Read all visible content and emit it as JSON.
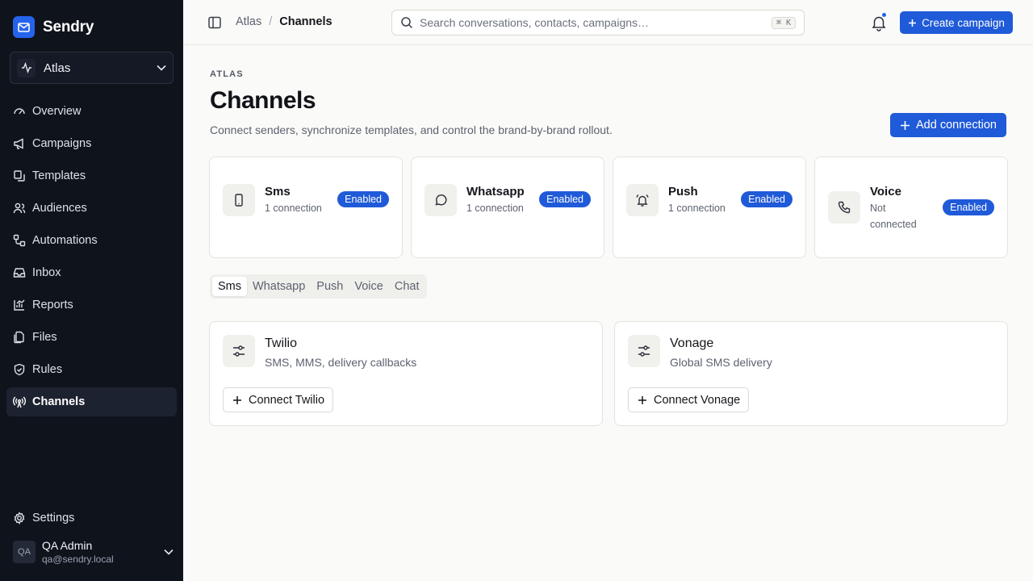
{
  "brand": {
    "name": "Sendry"
  },
  "workspace": {
    "name": "Atlas"
  },
  "sidebar": {
    "items": [
      {
        "label": "Overview",
        "icon": "gauge-icon"
      },
      {
        "label": "Campaigns",
        "icon": "megaphone-icon"
      },
      {
        "label": "Templates",
        "icon": "templates-icon"
      },
      {
        "label": "Audiences",
        "icon": "users-icon"
      },
      {
        "label": "Automations",
        "icon": "workflow-icon"
      },
      {
        "label": "Inbox",
        "icon": "inbox-icon"
      },
      {
        "label": "Reports",
        "icon": "chart-icon"
      },
      {
        "label": "Files",
        "icon": "files-icon"
      },
      {
        "label": "Rules",
        "icon": "shield-icon"
      },
      {
        "label": "Channels",
        "icon": "radio-tower-icon",
        "active": true
      }
    ],
    "settings_label": "Settings"
  },
  "user": {
    "initials": "QA",
    "name": "QA Admin",
    "email": "qa@sendry.local"
  },
  "topbar": {
    "breadcrumb": [
      "Atlas",
      "Channels"
    ],
    "search_placeholder": "Search conversations, contacts, campaigns…",
    "search_shortcut": "⌘ K",
    "create_label": "Create campaign"
  },
  "page": {
    "eyebrow": "ATLAS",
    "title": "Channels",
    "description": "Connect senders, synchronize templates, and control the brand-by-brand rollout.",
    "add_label": "Add connection"
  },
  "channels": [
    {
      "name": "Sms",
      "status": "1 connection",
      "badge": "Enabled",
      "icon": "phone-device-icon"
    },
    {
      "name": "Whatsapp",
      "status": "1 connection",
      "badge": "Enabled",
      "icon": "chat-bubble-icon"
    },
    {
      "name": "Push",
      "status": "1 connection",
      "badge": "Enabled",
      "icon": "bell-ring-icon"
    },
    {
      "name": "Voice",
      "status": "Not connected",
      "badge": "Enabled",
      "icon": "phone-call-icon"
    }
  ],
  "tabs": [
    "Sms",
    "Whatsapp",
    "Push",
    "Voice",
    "Chat"
  ],
  "active_tab": "Sms",
  "providers": [
    {
      "name": "Twilio",
      "description": "SMS, MMS, delivery callbacks",
      "button": "Connect Twilio"
    },
    {
      "name": "Vonage",
      "description": "Global SMS delivery",
      "button": "Connect Vonage"
    }
  ],
  "colors": {
    "accent": "#1f5ad8",
    "sidebar_bg": "#0f131c",
    "page_bg": "#fafaf8"
  }
}
